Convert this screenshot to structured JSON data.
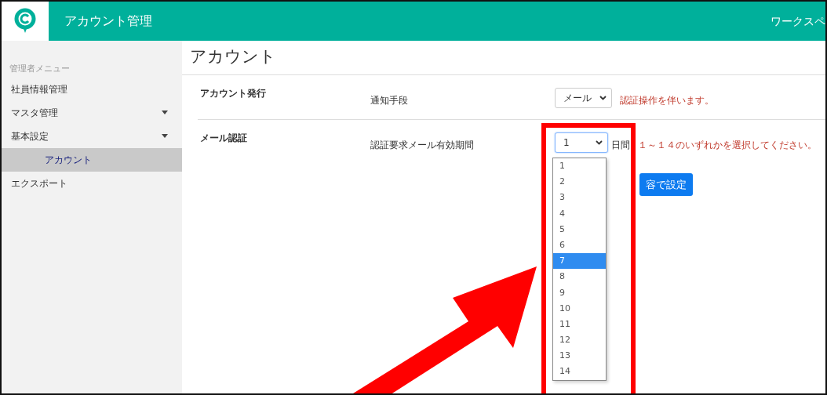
{
  "header": {
    "title": "アカウント管理",
    "workspace": "ワークスペ"
  },
  "sidebar": {
    "heading": "管理者メニュー",
    "items": [
      {
        "label": "社員情報管理",
        "kind": "link",
        "selected": false
      },
      {
        "label": "マスタ管理",
        "kind": "group",
        "selected": false
      },
      {
        "label": "基本設定",
        "kind": "group",
        "selected": false,
        "children": [
          {
            "label": "アカウント",
            "selected": true
          }
        ]
      },
      {
        "label": "エクスポート",
        "kind": "link",
        "selected": false
      }
    ]
  },
  "page_title": "アカウント",
  "sections": [
    {
      "heading": "アカウント発行",
      "label": "通知手段",
      "value": "メール",
      "note": "認証操作を伴います。"
    },
    {
      "heading": "メール認証",
      "label": "認証要求メール有効期間",
      "value": "1",
      "unit": "日間",
      "note": "１～１４のいずれかを選択してください。",
      "open": true
    }
  ],
  "dropdown_options": [
    {
      "label": "1",
      "selected": false
    },
    {
      "label": "2",
      "selected": false
    },
    {
      "label": "3",
      "selected": false
    },
    {
      "label": "4",
      "selected": false
    },
    {
      "label": "5",
      "selected": false
    },
    {
      "label": "6",
      "selected": false
    },
    {
      "label": "7",
      "selected": true
    },
    {
      "label": "8",
      "selected": false
    },
    {
      "label": "9",
      "selected": false
    },
    {
      "label": "10",
      "selected": false
    },
    {
      "label": "11",
      "selected": false
    },
    {
      "label": "12",
      "selected": false
    },
    {
      "label": "13",
      "selected": false
    },
    {
      "label": "14",
      "selected": false
    }
  ],
  "save_button": "容で設定"
}
